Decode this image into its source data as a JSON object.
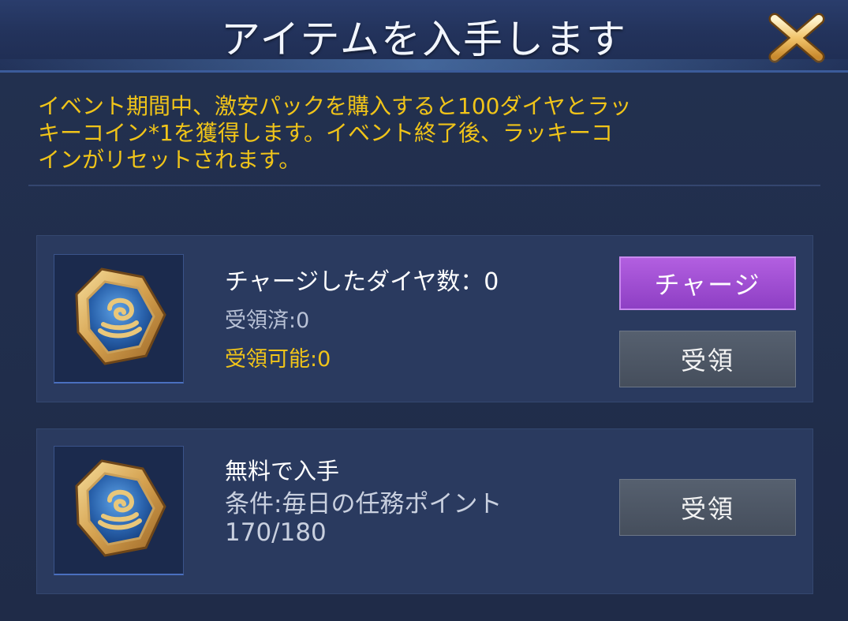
{
  "dialog": {
    "title": "アイテムを入手します",
    "description": "イベント期間中、激安パックを購入すると100ダイヤとラッ\nキーコイン*1を獲得します。イベント終了後、ラッキーコ\nインがリセットされます。"
  },
  "rewards": [
    {
      "line1": "チャージしたダイヤ数：0",
      "line2": "受領済:0",
      "line3": "受領可能:0",
      "charge_label": "チャージ",
      "claim_label": "受領"
    },
    {
      "line1": "無料で入手",
      "condition_line1": "条件:毎日の任務ポイント",
      "condition_line2": "170/180",
      "claim_label": "受領"
    }
  ],
  "icons": {
    "close": "close-icon",
    "reward": "lucky-coin-icon"
  },
  "colors": {
    "highlight_text": "#f0c419",
    "charge_button": "#9d4bd0",
    "claim_button": "#4d5665",
    "panel_bg": "#1f2b48"
  }
}
